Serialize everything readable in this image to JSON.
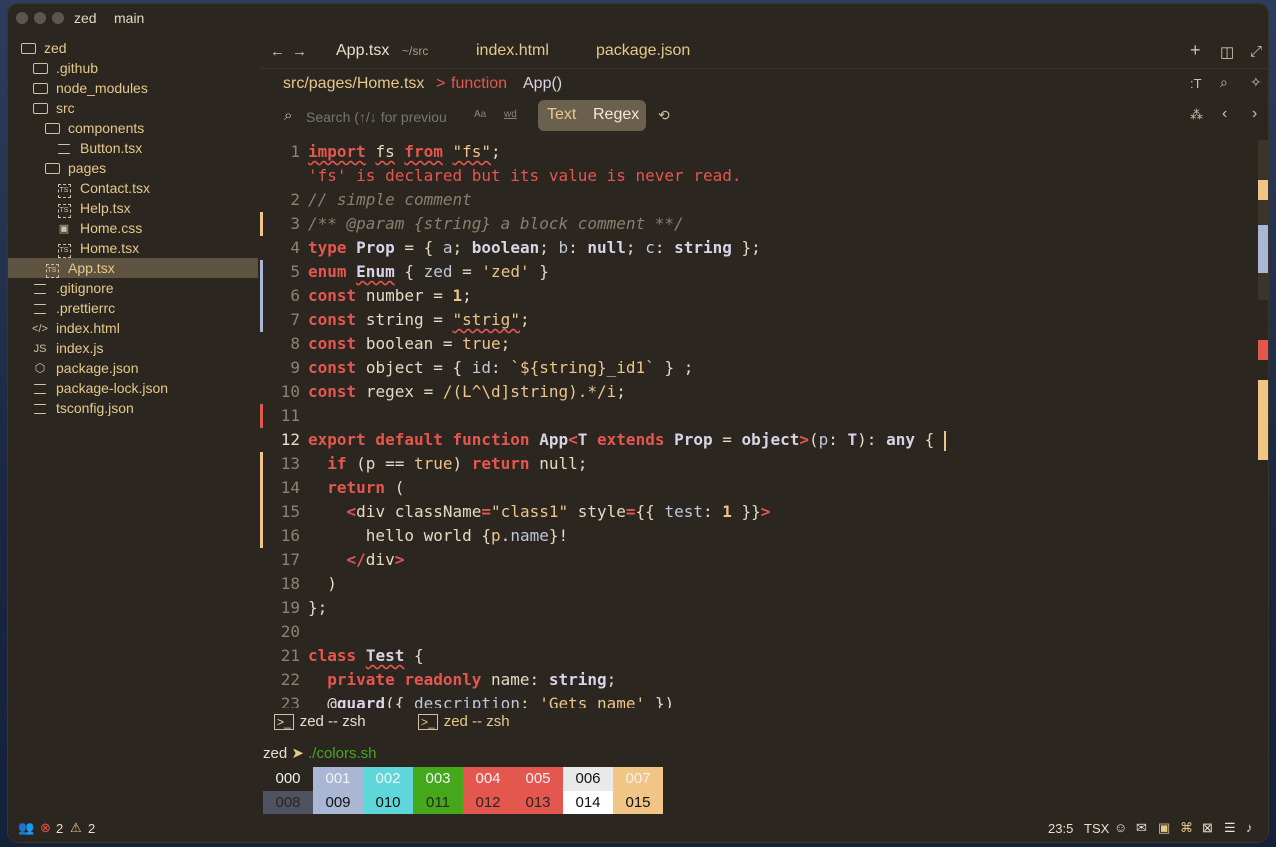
{
  "titlebar": {
    "project": "zed",
    "branch": "main"
  },
  "sidebar": {
    "items": [
      {
        "label": "zed",
        "icon": "folder-open-icon",
        "depth": 0
      },
      {
        "label": ".github",
        "icon": "folder-icon",
        "depth": 1
      },
      {
        "label": "node_modules",
        "icon": "folder-icon",
        "depth": 1
      },
      {
        "label": "src",
        "icon": "folder-open-icon",
        "depth": 1
      },
      {
        "label": "components",
        "icon": "folder-open-icon",
        "depth": 2
      },
      {
        "label": "Button.tsx",
        "icon": "file-icon",
        "depth": 3
      },
      {
        "label": "pages",
        "icon": "folder-open-icon",
        "depth": 2
      },
      {
        "label": "Contact.tsx",
        "icon": "typescript-icon",
        "depth": 3
      },
      {
        "label": "Help.tsx",
        "icon": "typescript-icon",
        "depth": 3
      },
      {
        "label": "Home.css",
        "icon": "css-icon",
        "depth": 3
      },
      {
        "label": "Home.tsx",
        "icon": "typescript-icon",
        "depth": 3
      },
      {
        "label": "App.tsx",
        "icon": "typescript-icon",
        "depth": 2,
        "selected": true
      },
      {
        "label": ".gitignore",
        "icon": "lines-icon",
        "depth": 1
      },
      {
        "label": ".prettierrc",
        "icon": "settings-lines-icon",
        "depth": 1
      },
      {
        "label": "index.html",
        "icon": "code-icon",
        "depth": 1
      },
      {
        "label": "index.js",
        "icon": "js-icon",
        "depth": 1
      },
      {
        "label": "package.json",
        "icon": "package-icon",
        "depth": 1
      },
      {
        "label": "package-lock.json",
        "icon": "lines-icon",
        "depth": 1
      },
      {
        "label": "tsconfig.json",
        "icon": "lines-icon",
        "depth": 1
      }
    ]
  },
  "tabs": [
    {
      "label": "App.tsx",
      "sub": "~/src",
      "active": true
    },
    {
      "label": "index.html"
    },
    {
      "label": "package.json"
    }
  ],
  "breadcrumb": {
    "path": "src/pages/Home.tsx",
    "sep": ">",
    "kind": "function",
    "name": "App()"
  },
  "search": {
    "placeholder": "Search (↑/↓ for previou",
    "case_label": "Aa",
    "word_label": "wd",
    "mode_text": "Text",
    "mode_regex": "Regex"
  },
  "code": {
    "diagnostic": "'fs' is declared but its value is never read.",
    "line_numbers": [
      "1",
      "2",
      "3",
      "4",
      "5",
      "6",
      "7",
      "8",
      "9",
      "10",
      "11",
      "12",
      "13",
      "14",
      "15",
      "16",
      "17",
      "18",
      "19",
      "20",
      "21",
      "22",
      "23"
    ]
  },
  "terminal": {
    "tabs": [
      "zed -- zsh",
      "zed -- zsh"
    ],
    "prompt_dir": "zed",
    "prompt_arrow": "➤",
    "command": "./colors.sh",
    "row1": [
      "000",
      "001",
      "002",
      "003",
      "004",
      "005",
      "006",
      "007"
    ],
    "row2": [
      "008",
      "009",
      "010",
      "011",
      "012",
      "013",
      "014",
      "015"
    ],
    "colors1": [
      "#2b2620",
      "#a9b6d4",
      "#5fd6d9",
      "#45a81b",
      "#e4574f",
      "#e4574f",
      "#e9e9e9",
      "#f0c585"
    ],
    "colors2": [
      "#4d5361",
      "#a9b6d4",
      "#5fd6d9",
      "#45a81b",
      "#e4574f",
      "#e4574f",
      "#ffffff",
      "#f0c585"
    ]
  },
  "status": {
    "errors": "2",
    "warnings": "2",
    "position": "23:5",
    "language": "TSX"
  },
  "colors": {
    "accent": "#e6c98a",
    "keyword": "#e4574f",
    "string": "#efc48a"
  }
}
